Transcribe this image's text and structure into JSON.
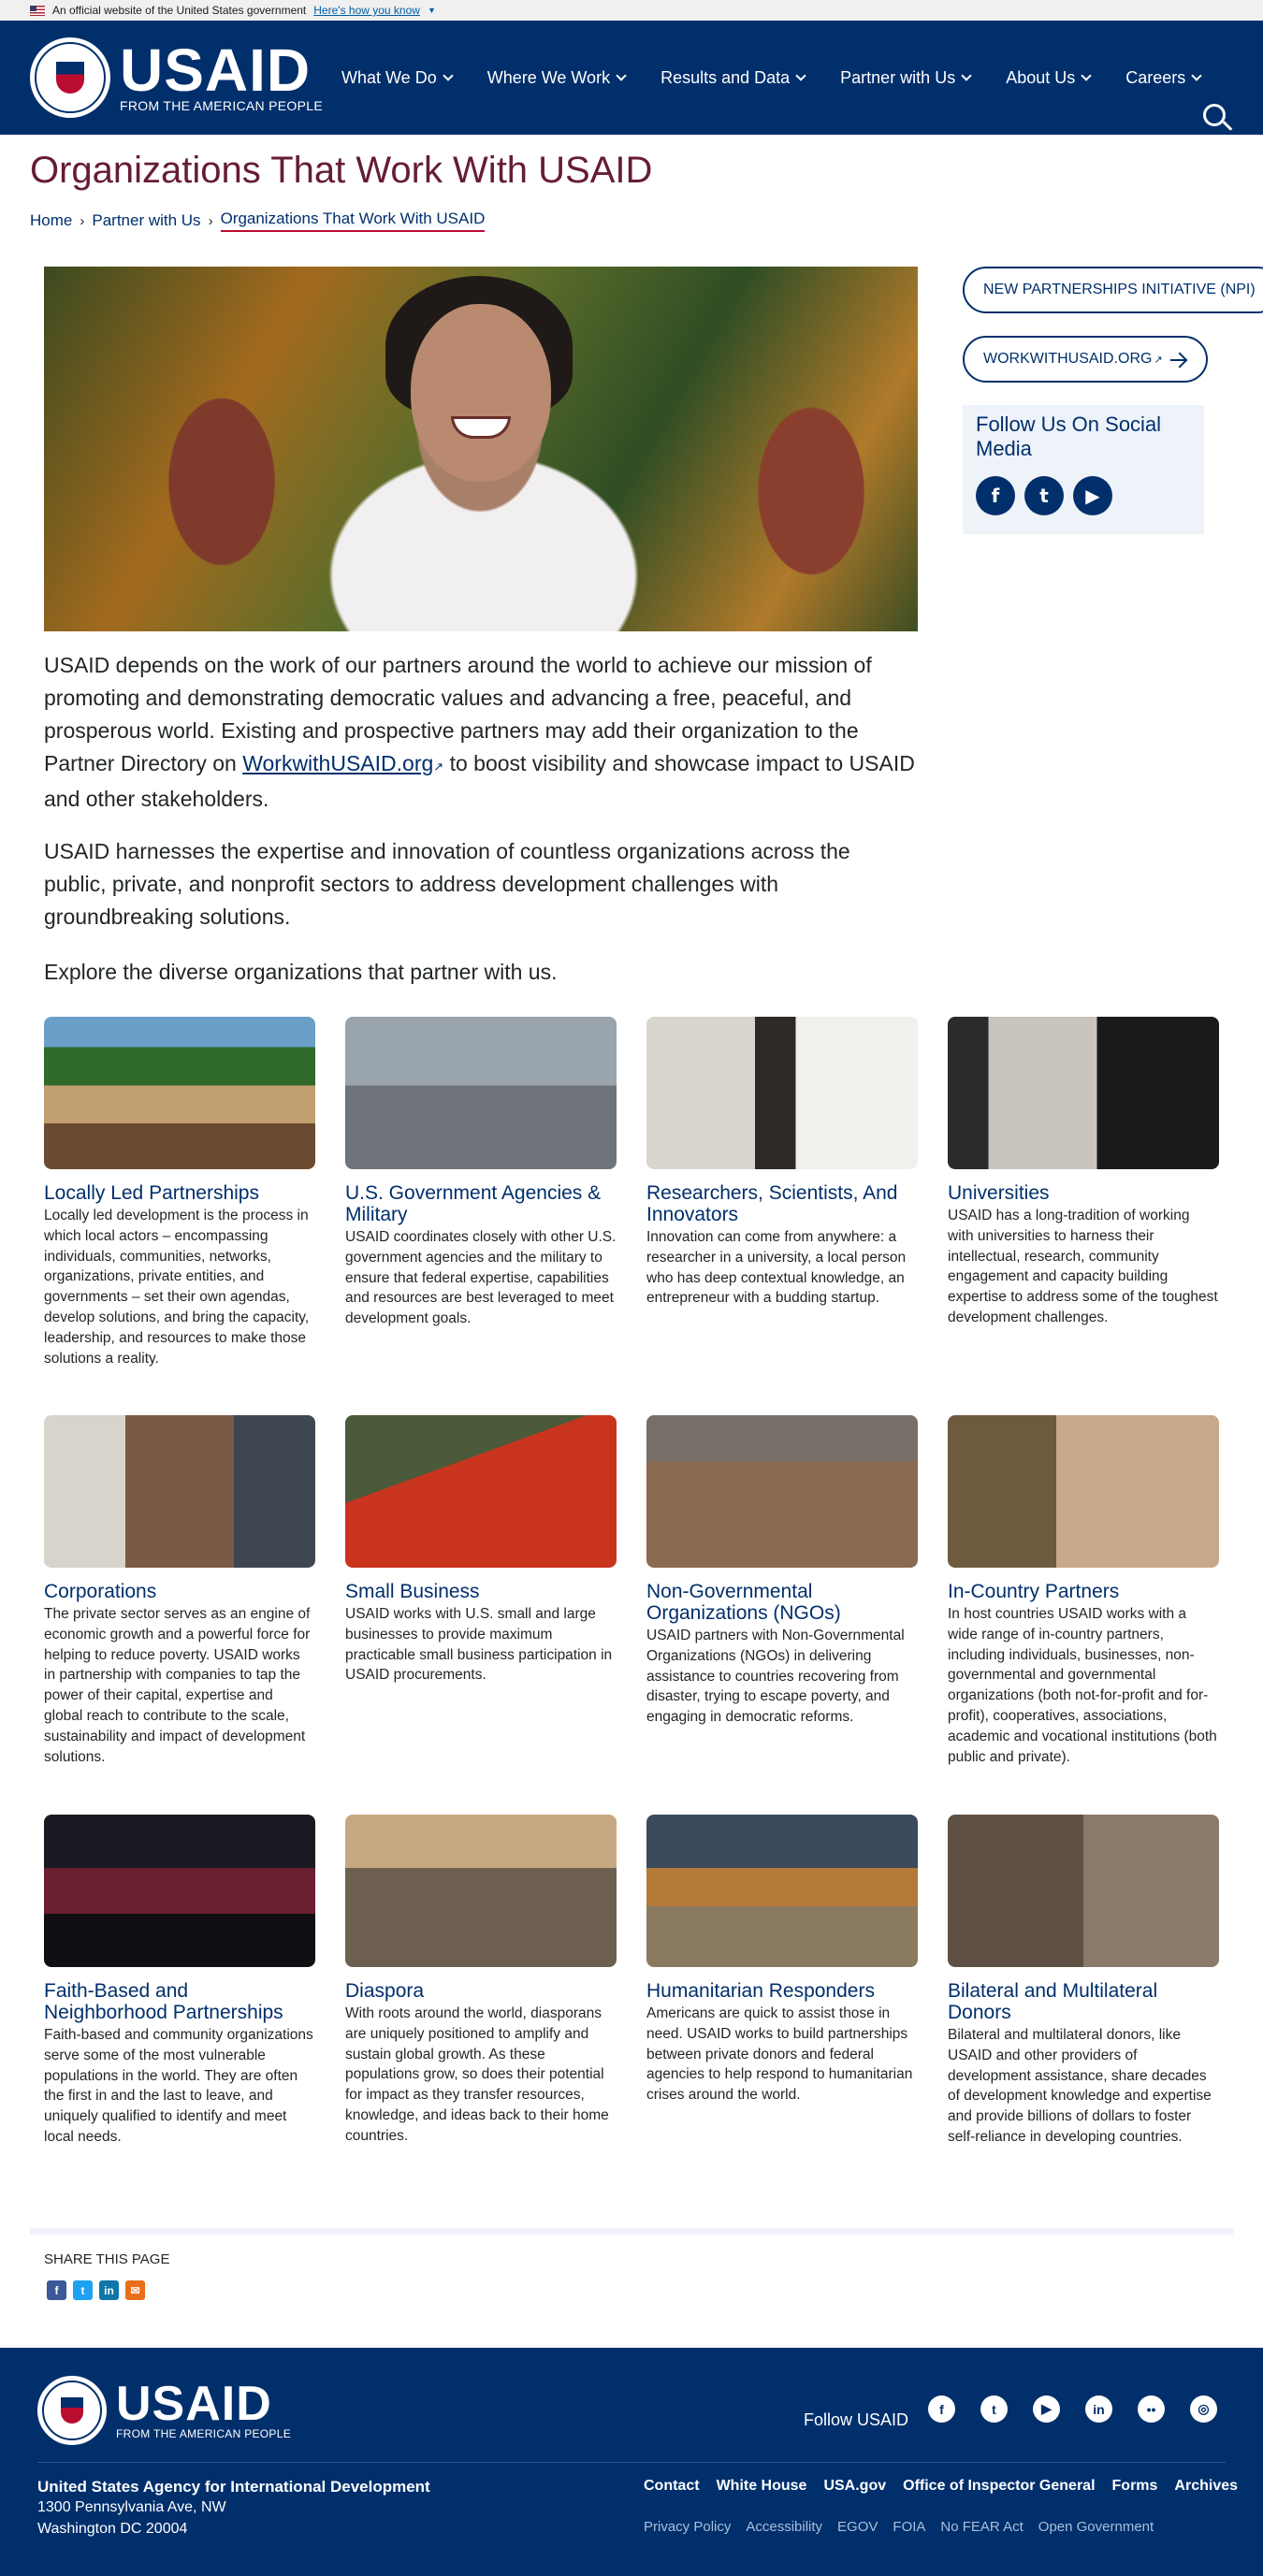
{
  "banner": {
    "text": "An official website of the United States government",
    "how": "Here's how you know"
  },
  "header": {
    "logo_word": "USAID",
    "logo_tag": "FROM THE AMERICAN PEOPLE",
    "nav": [
      "What We Do",
      "Where We Work",
      "Results and Data",
      "Partner with Us",
      "About Us",
      "Careers"
    ]
  },
  "page": {
    "title": "Organizations That Work With USAID",
    "breadcrumb": [
      "Home",
      "Partner with Us",
      "Organizations That Work With USAID"
    ]
  },
  "sidebar": {
    "npi": "NEW PARTNERSHIPS INITIATIVE (NPI)",
    "wwu": "WORKWITHUSAID.ORG",
    "follow_heading": "Follow Us On Social Media",
    "icons": [
      "facebook-icon",
      "twitter-icon",
      "youtube-icon"
    ]
  },
  "intro": {
    "p1_before": "USAID depends on the work of our partners around the world to achieve our mission of promoting and demonstrating democratic values and advancing a free, peaceful, and prosperous world. Existing and prospective partners may add their organization to the Partner Directory on ",
    "p1_link": "WorkwithUSAID.org",
    "p1_after": " to boost visibility and showcase impact to USAID and other stakeholders.",
    "p2": "USAID harnesses the expertise and innovation of countless organizations across the public, private, and nonprofit sectors to address development challenges with groundbreaking solutions.",
    "p3": "Explore the diverse organizations that partner with us."
  },
  "cards": [
    {
      "title": "Locally Led Partnerships",
      "desc": "Locally led development is the process in which local actors – encompassing individuals, communities, networks, organizations, private entities, and governments – set their own agendas, develop solutions, and bring the capacity, leadership, and resources to make those solutions a reality."
    },
    {
      "title": "U.S. Government Agencies & Military",
      "desc": "USAID coordinates closely with other U.S. government agencies and the military to ensure that federal expertise, capabilities and resources are best leveraged to meet development goals."
    },
    {
      "title": "Researchers, Scientists, And Innovators",
      "desc": "Innovation can come from anywhere: a researcher in a university, a local person who has deep contextual knowledge, an entrepreneur with a budding startup."
    },
    {
      "title": "Universities",
      "desc": "USAID has a long-tradition of working with universities to harness their intellectual, research, community engagement and capacity building expertise to address some of the toughest development challenges."
    },
    {
      "title": "Corporations",
      "desc": "The private sector serves as an engine of economic growth and a powerful force for helping to reduce poverty. USAID works in partnership with companies to tap the power of their capital, expertise and global reach to contribute to the scale, sustainability and impact of development solutions."
    },
    {
      "title": "Small Business",
      "desc": "USAID works with U.S. small and large businesses to provide maximum practicable small business participation in USAID procurements."
    },
    {
      "title": "Non-Governmental Organizations (NGOs)",
      "desc": "USAID partners with Non-Governmental Organizations (NGOs) in delivering assistance to countries recovering from disaster, trying to escape poverty, and engaging in democratic reforms."
    },
    {
      "title": "In-Country Partners",
      "desc": "In host countries USAID works with a wide range of in-country partners, including individuals, businesses, non-governmental and governmental organizations (both not-for-profit and for-profit), cooperatives, associations, academic and vocational institutions (both public and private)."
    },
    {
      "title": "Faith-Based and Neighborhood Partnerships",
      "desc": "Faith-based and community organizations serve some of the most vulnerable populations in the world. They are often the first in and the last to leave, and uniquely qualified to identify and meet local needs."
    },
    {
      "title": "Diaspora",
      "desc": "With roots around the world, diasporans are uniquely positioned to amplify and sustain global growth. As these populations grow, so does their potential for impact as they transfer resources, knowledge, and ideas back to their home countries."
    },
    {
      "title": "Humanitarian Responders",
      "desc": "Americans are quick to assist those in need. USAID works to build partnerships between private donors and federal agencies to help respond to humanitarian crises around the world."
    },
    {
      "title": "Bilateral and Multilateral Donors",
      "desc": "Bilateral and multilateral donors, like USAID and other providers of development assistance, share decades of development knowledge and expertise and provide billions of dollars to foster self-reliance in developing countries."
    }
  ],
  "share": {
    "label": "SHARE THIS PAGE",
    "icons": [
      "facebook-icon",
      "twitter-icon",
      "linkedin-icon",
      "email-icon"
    ]
  },
  "footer": {
    "logo_word": "USAID",
    "logo_tag": "FROM THE AMERICAN PEOPLE",
    "follow": "Follow USAID",
    "social": [
      "facebook-icon",
      "twitter-icon",
      "youtube-icon",
      "linkedin-icon",
      "flickr-icon",
      "instagram-icon"
    ],
    "agency": "United States Agency for International Development",
    "addr1": "1300 Pennsylvania Ave, NW",
    "addr2": "Washington DC 20004",
    "links": [
      "Contact",
      "White House",
      "USA.gov",
      "Office of Inspector General",
      "Forms",
      "Archives"
    ],
    "sub_links": [
      "Privacy Policy",
      "Accessibility",
      "EGOV",
      "FOIA",
      "No FEAR Act",
      "Open Government"
    ]
  },
  "colors": {
    "navy": "#002f6c",
    "maroon": "#651d32",
    "red": "#ba0c2f"
  }
}
